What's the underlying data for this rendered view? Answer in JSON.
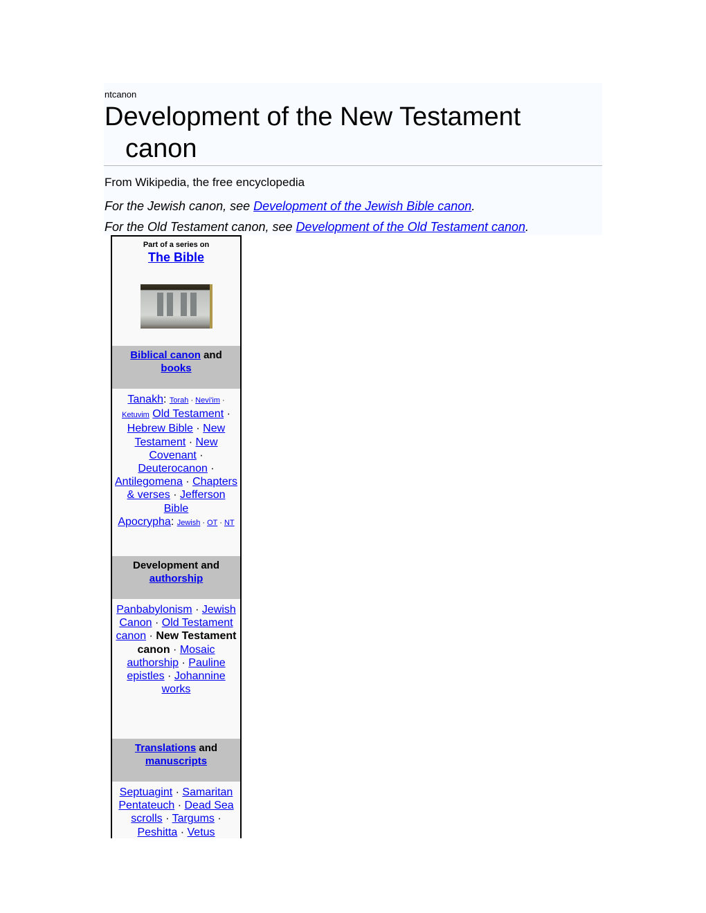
{
  "page": {
    "breadcrumb": "ntcanon",
    "title_line1": "Development of the New Testament",
    "title_line2": "canon",
    "tagline": "From Wikipedia, the free encyclopedia",
    "hatnotes": [
      {
        "prefix": "For the Jewish canon, see ",
        "link": "Development of the Jewish Bible canon",
        "suffix": "."
      },
      {
        "prefix": "For the Old Testament canon, see ",
        "link": "Development of the Old Testament canon",
        "suffix": "."
      }
    ]
  },
  "infobox": {
    "series_label": "Part of a series on",
    "series_title": "The Bible",
    "image_alt": "Open Bible",
    "sections": [
      {
        "header_link1": "Biblical canon",
        "header_text": " and",
        "header_link2": "books",
        "items": [
          "Tanakh",
          "Torah",
          "Nevi'im",
          "Ketuvim",
          "Old Testament",
          "Hebrew Bible",
          "New Testament",
          "New Covenant",
          "Deuterocanon",
          "Antilegomena",
          "Chapters & verses",
          "Jefferson Bible",
          "Apocrypha",
          "Jewish",
          "OT",
          "NT"
        ]
      },
      {
        "header_text": "Development and",
        "header_link": "authorship",
        "items": [
          "Panbabylonism",
          "Jewish Canon",
          "Old Testament canon",
          "New Testament canon",
          "Mosaic authorship",
          "Pauline epistles",
          "Johannine works"
        ]
      },
      {
        "header_link1": "Translations",
        "header_text": " and",
        "header_link2": "manuscripts",
        "items": [
          "Septuagint",
          "Samaritan Pentateuch",
          "Dead Sea scrolls",
          "Targums",
          "Peshitta",
          "Vetus"
        ]
      }
    ],
    "separator": " · "
  }
}
